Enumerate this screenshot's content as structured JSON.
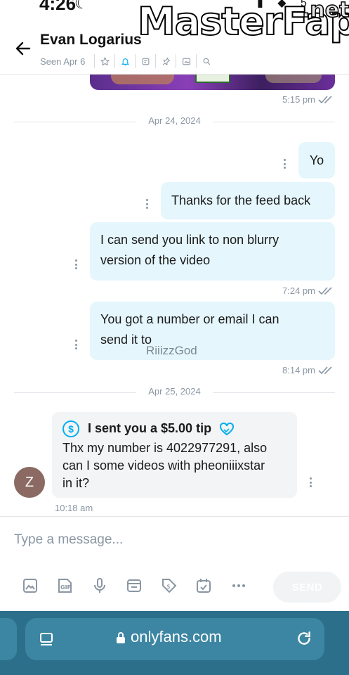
{
  "status_bar": {
    "time": "4:26",
    "moon": "☾",
    "icons": "▮ ◆ 5"
  },
  "watermark": {
    "main": "MasterFap",
    "suffix": ".net",
    "small": "RiiizzGod"
  },
  "header": {
    "back_glyph": "←",
    "contact_name": "Evan Logarius",
    "seen": "Seen Apr 6",
    "icons": [
      "star-icon",
      "bell-icon",
      "note-icon",
      "pin-icon",
      "gallery-icon",
      "search-icon"
    ]
  },
  "thread": {
    "first_time": "5:15 pm",
    "divider_1": "Apr 24, 2024",
    "messages": [
      {
        "text": "Yo"
      },
      {
        "text": "Thanks for the feed back"
      },
      {
        "line1": "I can send you link to non blurry",
        "line2": "version of the video",
        "time": "7:24 pm"
      },
      {
        "line1": "You got a number or email I can",
        "line2": "send it to",
        "time": "8:14 pm"
      }
    ],
    "divider_2": "Apr 25, 2024",
    "incoming": {
      "tip_icon": "$",
      "tip_text": "I sent you a $5.00 tip",
      "line1": "Thx my number is 4022977291, also",
      "line2": "can I some videos with pheoniiixstar",
      "line3": "in it?",
      "avatar_letter": "Z",
      "time": "10:18 am"
    }
  },
  "composer": {
    "placeholder": "Type a message...",
    "send_label": "SEND",
    "tools": [
      "image-icon",
      "gif-icon",
      "microphone-icon",
      "vault-icon",
      "price-tag-icon",
      "schedule-icon",
      "more-icon"
    ]
  },
  "browser": {
    "url": "onlyfans.com"
  },
  "colors": {
    "accent": "#00aff0",
    "bubble": "#e5f6fd",
    "incoming": "#f2f4f5",
    "browser": "#2b6f8a",
    "muted": "#8a96a3"
  }
}
